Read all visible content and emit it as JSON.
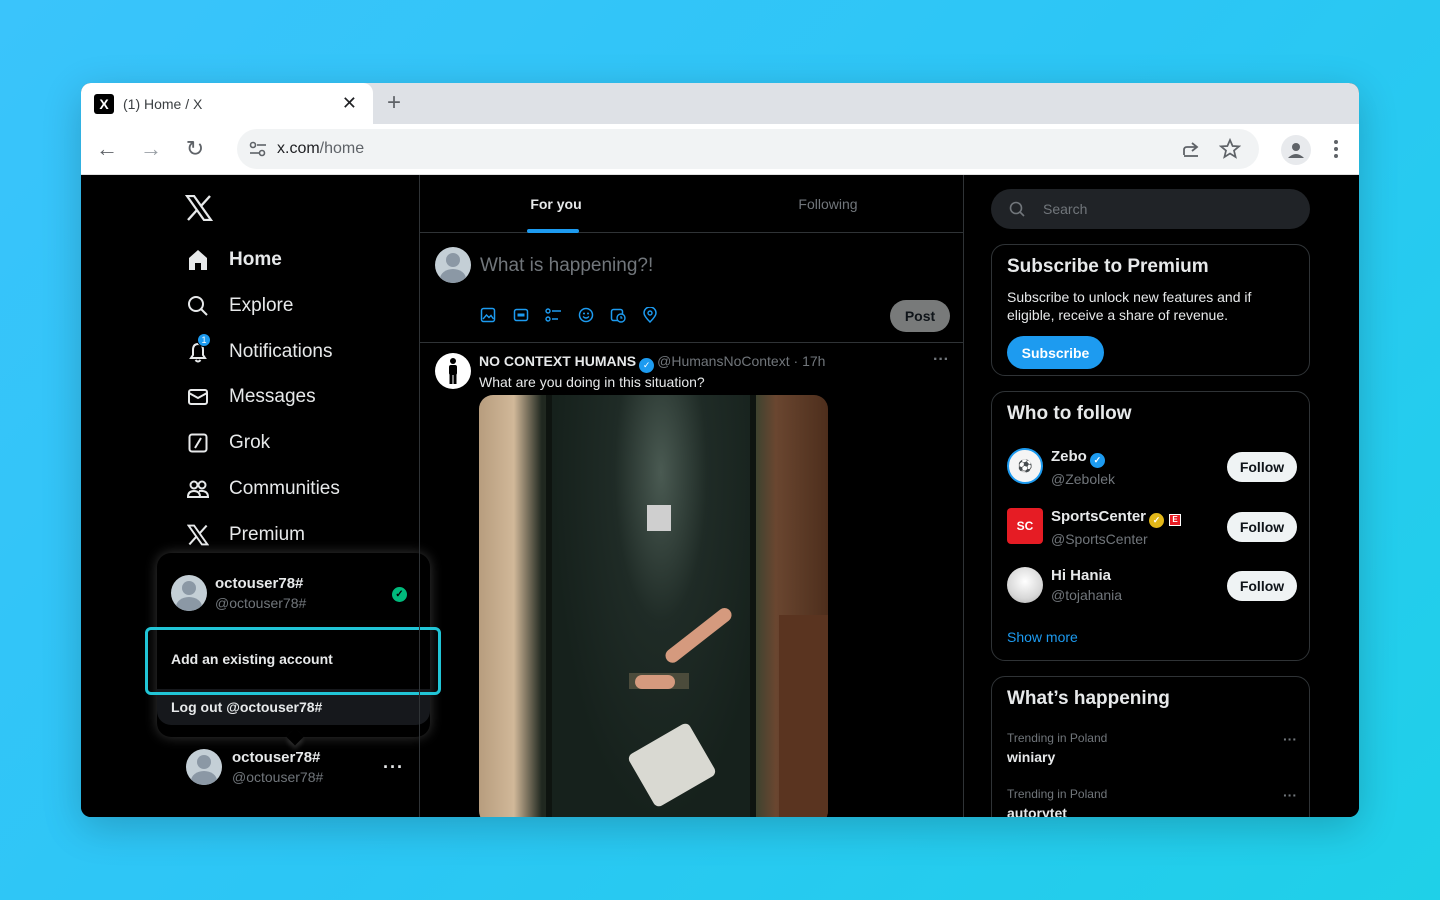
{
  "browser": {
    "tab_title": "(1) Home / X",
    "tab_close": "✕",
    "new_tab": "+",
    "url_host": "x.com",
    "url_path": "/home",
    "back": "←",
    "forward": "→",
    "reload": "↻"
  },
  "nav": {
    "logo": "𝕏",
    "items": [
      {
        "label": "Home",
        "icon": "home-icon"
      },
      {
        "label": "Explore",
        "icon": "search-icon"
      },
      {
        "label": "Notifications",
        "icon": "bell-icon",
        "badge": "1"
      },
      {
        "label": "Messages",
        "icon": "mail-icon"
      },
      {
        "label": "Grok",
        "icon": "grok-icon"
      },
      {
        "label": "Communities",
        "icon": "people-icon"
      },
      {
        "label": "Premium",
        "icon": "x-icon"
      }
    ]
  },
  "account_popup": {
    "name": "octouser78#",
    "handle": "@octouser78#",
    "check": "✓",
    "add_account": "Add an existing account",
    "logout": "Log out @octouser78#"
  },
  "bottom_account": {
    "name": "octouser78#",
    "handle": "@octouser78#",
    "more": "···"
  },
  "feed": {
    "tabs": [
      "For you",
      "Following"
    ],
    "composer_placeholder": "What is happening?!",
    "post_label": "Post",
    "tweet": {
      "name": "NO CONTEXT HUMANS",
      "handle": "@HumansNoContext",
      "sep": " · ",
      "time": "17h",
      "text": "What are you doing in this situation?",
      "more": "···"
    }
  },
  "sidebar": {
    "search_placeholder": "Search",
    "premium": {
      "title": "Subscribe to Premium",
      "desc": "Subscribe to unlock new features and if eligible, receive a share of revenue.",
      "button": "Subscribe"
    },
    "who_to_follow": {
      "title": "Who to follow",
      "follow_label": "Follow",
      "accounts": [
        {
          "name": "Zebo",
          "handle": "@Zebolek"
        },
        {
          "name": "SportsCenter",
          "handle": "@SportsCenter",
          "badge": "E"
        },
        {
          "name": "Hi Hania",
          "handle": "@tojahania"
        }
      ],
      "show_more": "Show more"
    },
    "happening": {
      "title": "What’s happening",
      "trends": [
        {
          "category": "Trending in Poland",
          "name": "winiary"
        },
        {
          "category": "Trending in Poland",
          "name": "autorytet"
        }
      ],
      "more": "···"
    }
  },
  "colors": {
    "accent": "#1d9bf0",
    "highlight": "#21c5d6",
    "verified_gold": "#e2b719",
    "success": "#00ba7c"
  }
}
